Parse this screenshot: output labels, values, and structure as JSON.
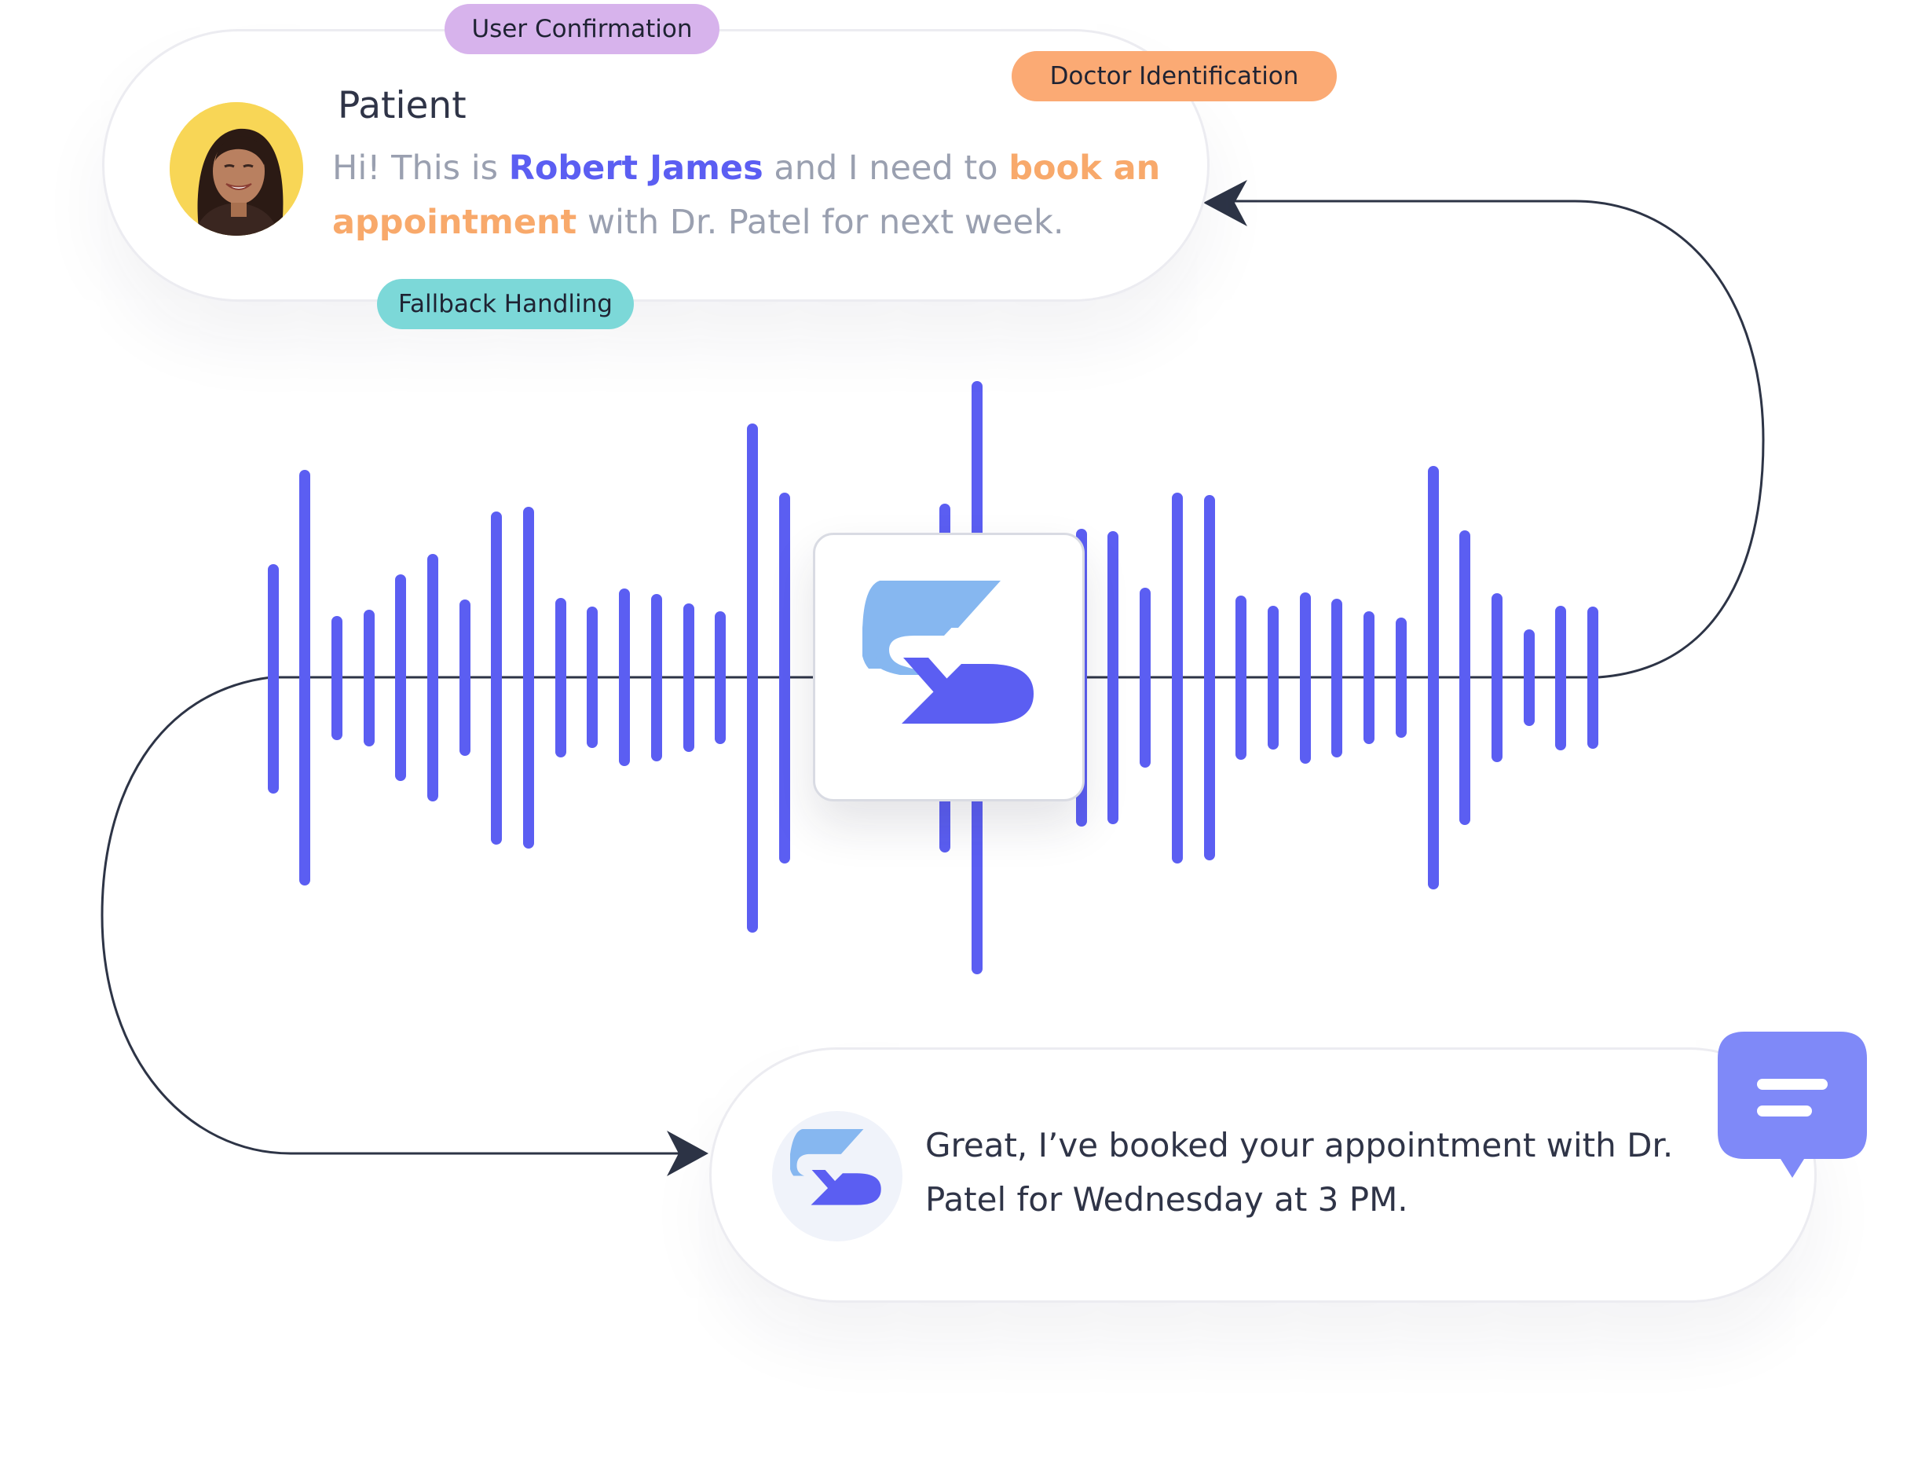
{
  "patient": {
    "speaker": "Patient",
    "message_parts": {
      "intro": "Hi! This is ",
      "name": "Robert James",
      "middle": " and I need to ",
      "intent": "book an appointment",
      "end": " with Dr. Patel for next week."
    }
  },
  "assistant": {
    "message": "Great, I’ve booked your appointment with Dr. Patel for Wednesday at 3 PM."
  },
  "tags": {
    "user_confirmation": "User Confirmation",
    "doctor_identification": "Doctor Identification",
    "fallback_handling": "Fallback Handling"
  },
  "icons": {
    "avatar": "patient-avatar",
    "center_logo": "brand-logo-icon",
    "assistant_avatar": "brand-logo-icon",
    "chat_badge": "chat-bubble-icon"
  },
  "colors": {
    "accent_blue": "#5b5ef2",
    "waveform": "#5b5ef2",
    "highlight_orange": "#f8a96b",
    "tag_purple": "#d7b3ec",
    "tag_orange": "#fbaa74",
    "tag_teal": "#7cd8d8",
    "connector": "#2d3446",
    "chat_badge": "#7f89f8"
  }
}
